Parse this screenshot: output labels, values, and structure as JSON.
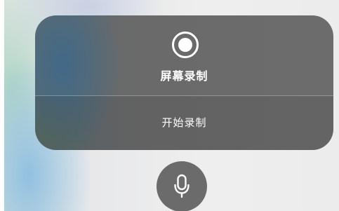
{
  "screen_recording": {
    "title": "屏幕录制",
    "start_label": "开始录制",
    "record_icon": "record-icon",
    "mic_icon": "microphone-icon"
  },
  "colors": {
    "panel_gray": "#6c6c6c",
    "panel_blue_tint": "#3c698c",
    "mic_button_gray": "#6b6b6b",
    "text": "#ffffff"
  }
}
